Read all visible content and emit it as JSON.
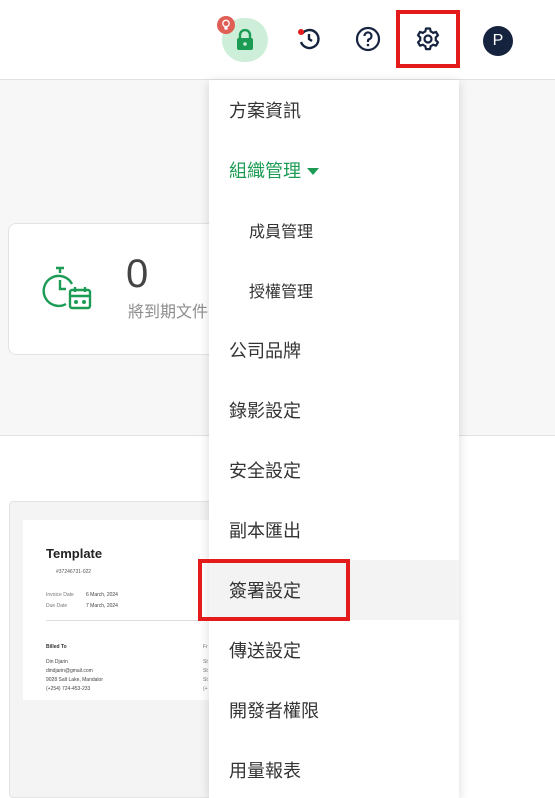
{
  "header": {
    "avatar_initial": "P",
    "lock_color": "#1c9b54",
    "badge_color": "#e05e55",
    "highlight_color": "#e41b1b"
  },
  "icons": {
    "lock": "lock-icon",
    "badge": "bulb-badge-icon",
    "history": "history-icon",
    "help": "help-icon",
    "settings": "gear-icon",
    "stat": "stopwatch-calendar-icon"
  },
  "stat_card": {
    "value": "0",
    "label": "將到期文件"
  },
  "template_preview": {
    "title": "Template",
    "number": "#37246731-022",
    "invoice_date_label": "Invoice Date",
    "invoice_date": "6 March, 2024",
    "due_date_label": "Due Date",
    "due_date": "7 March, 2024",
    "billed_to_label": "Billed To",
    "billed_lines": [
      "Din Djarin",
      "dindjarin@gmail.com",
      "9028 Salt Lake, Mandalor",
      "(+254) 724-453-233"
    ],
    "from_label": "Fr",
    "from_lines": [
      "St",
      "St",
      "St",
      "(+"
    ]
  },
  "menu": {
    "items": [
      {
        "label": "方案資訊"
      },
      {
        "label": "組織管理"
      },
      {
        "label": "成員管理"
      },
      {
        "label": "授權管理"
      },
      {
        "label": "公司品牌"
      },
      {
        "label": "錄影設定"
      },
      {
        "label": "安全設定"
      },
      {
        "label": "副本匯出"
      },
      {
        "label": "簽署設定"
      },
      {
        "label": "傳送設定"
      },
      {
        "label": "開發者權限"
      },
      {
        "label": "用量報表"
      }
    ],
    "active_color": "#1c9b54"
  }
}
